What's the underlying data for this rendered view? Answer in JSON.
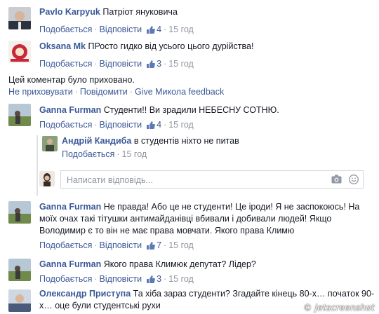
{
  "comments": [
    {
      "author": "Pavlo Karpyuk",
      "text": "Патріот януковича",
      "like_label": "Подобається",
      "reply_label": "Відповісти",
      "likes": "4",
      "time": "15 год"
    },
    {
      "author": "Oksana Mk",
      "text": "ПРосто гидко від усього цього дурійства!",
      "like_label": "Подобається",
      "reply_label": "Відповісти",
      "likes": "3",
      "time": "15 год"
    },
    {
      "author": "Ganna Furman",
      "text": "Студенти!! Ви зрадили НЕБЕСНУ СОТНЮ.",
      "like_label": "Подобається",
      "reply_label": "Відповісти",
      "likes": "4",
      "time": "15 год"
    },
    {
      "author": "Андрій Кандиба",
      "text": "в студентів ніхто не питав",
      "like_label": "Подобається",
      "time": "15 год"
    },
    {
      "author": "Ganna Furman",
      "text": "Не правда! Або це не студенти! Це іроди! Я не заспокоюсь! На моїх очах такі тітушки антимайданівці вбивали і добивали людей! Якщо Володимир є то він не має права мовчати. Якого права Климю",
      "like_label": "Подобається",
      "reply_label": "Відповісти",
      "likes": "7",
      "time": "15 год"
    },
    {
      "author": "Ganna Furman",
      "text": "Якого права Климюк депутат? Лідер?",
      "like_label": "Подобається",
      "reply_label": "Відповісти",
      "likes": "3",
      "time": "15 год"
    },
    {
      "author": "Олександр Приступа",
      "text": "Та хіба зараз студенти? Згадайте кінець 80-х… початок 90-х… оце були студентські рухи"
    }
  ],
  "hidden_comment": {
    "notice": "Цей коментар було приховано.",
    "unhide": "Не приховувати",
    "report": "Повідомити",
    "feedback": "Give Микола feedback"
  },
  "reply_box": {
    "placeholder": "Написати відповідь..."
  },
  "watermark": "© jetscreenshot",
  "colors": {
    "link": "#3b5998",
    "meta": "#90949c",
    "text": "#141823"
  }
}
